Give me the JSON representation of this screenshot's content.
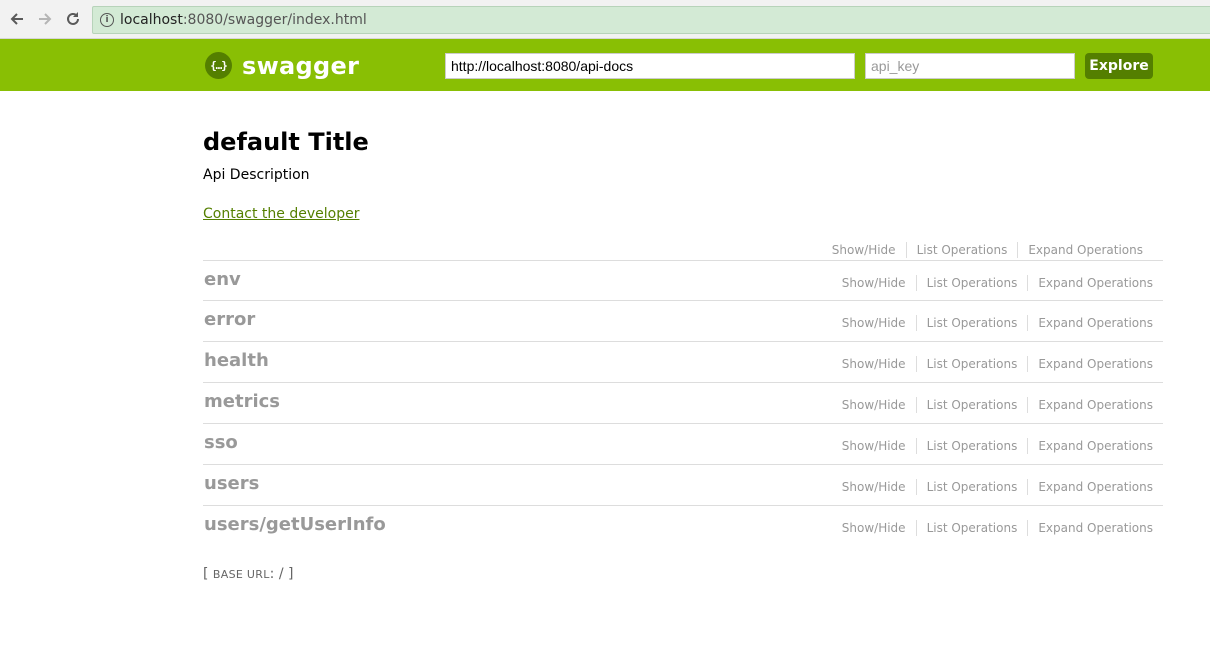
{
  "browser": {
    "url_host": "localhost",
    "url_rest": ":8080/swagger/index.html"
  },
  "header": {
    "logo_text": "swagger",
    "logo_icon": "{…}",
    "url_value": "http://localhost:8080/api-docs",
    "api_key_placeholder": "api_key",
    "explore_label": "Explore",
    "brand_color": "#89bf04",
    "accent_color": "#547f00"
  },
  "info": {
    "title": "default Title",
    "description": "Api Description",
    "contact_link": "Contact the developer"
  },
  "ops_labels": {
    "show_hide": "Show/Hide",
    "list": "List Operations",
    "expand": "Expand Operations"
  },
  "resources": [
    {
      "name": "env"
    },
    {
      "name": "error"
    },
    {
      "name": "health"
    },
    {
      "name": "metrics"
    },
    {
      "name": "sso"
    },
    {
      "name": "users"
    },
    {
      "name": "users/getUserInfo"
    }
  ],
  "footer": {
    "open": "[ ",
    "base_url_label": "base url",
    "close_value": ": / ]"
  }
}
